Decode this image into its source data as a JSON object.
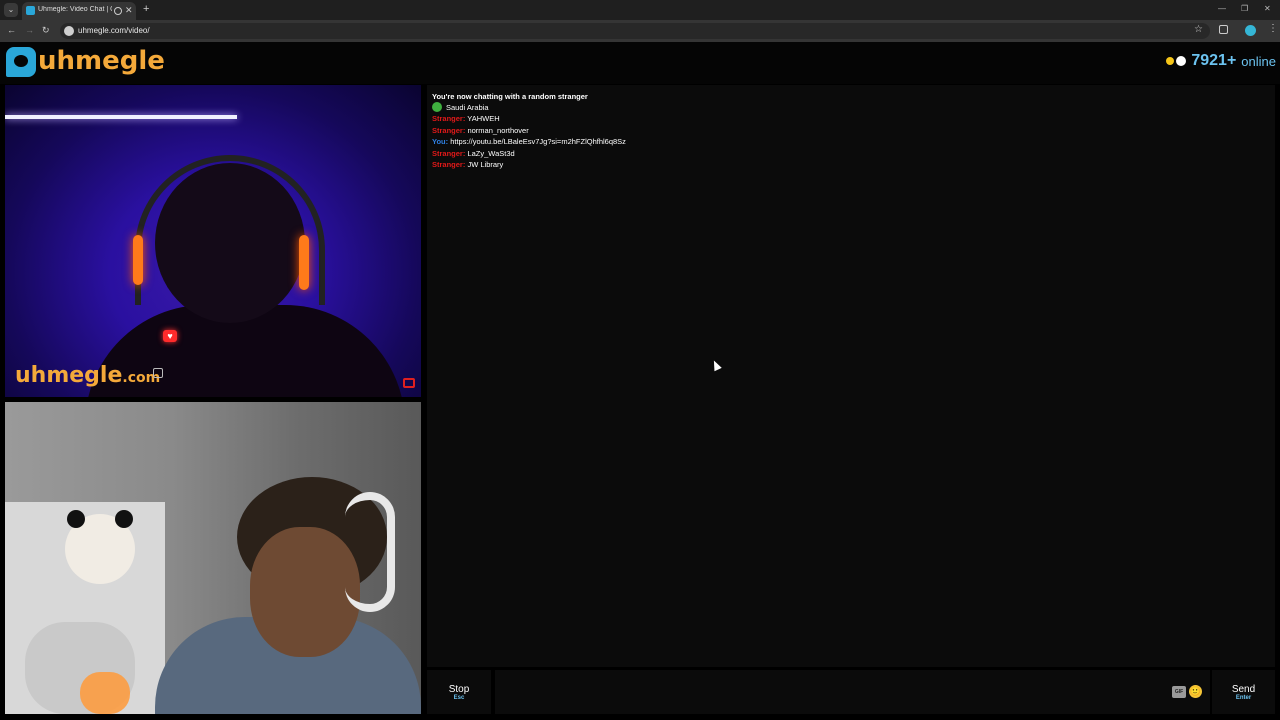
{
  "browser": {
    "tab_title": "Uhmegle: Video Chat | Om",
    "tab_close": "✕",
    "new_tab": "+",
    "url": "uhmegle.com/video/",
    "nav_back": "←",
    "nav_forward": "→",
    "nav_reload": "↻",
    "bookmark_icon": "☆",
    "menu_icon": "⋮",
    "win_min": "—",
    "win_restore": "❐",
    "win_close": "✕",
    "tab_search": "⌄"
  },
  "header": {
    "logo_text": "uhmegle",
    "online_count": "7921+",
    "online_label": "online"
  },
  "stranger_video": {
    "watermark": "uhmegle",
    "watermark_suffix": ".com"
  },
  "chat": {
    "status": "You're now chatting with a random stranger",
    "country": "Saudi Arabia",
    "messages": [
      {
        "sender": "Stranger:",
        "text": "YAHWEH",
        "from": "stranger"
      },
      {
        "sender": "Stranger:",
        "text": "norman_northover",
        "from": "stranger"
      },
      {
        "sender": "You:",
        "text": "https://youtu.be/LBaleEsv7Jg?si=m2hFZlQhfhl6q8Sz",
        "from": "you"
      },
      {
        "sender": "Stranger:",
        "text": "LaZy_WaSt3d",
        "from": "stranger"
      },
      {
        "sender": "Stranger:",
        "text": "JW Library",
        "from": "stranger"
      }
    ]
  },
  "controls": {
    "stop_label": "Stop",
    "stop_key": "Esc",
    "input_placeholder": "",
    "gif_label": "GIF",
    "emoji": "🙂",
    "send_label": "Send",
    "send_key": "Enter"
  },
  "colors": {
    "brand_blue": "#2aa7d9",
    "brand_orange": "#f4a93a",
    "stranger_red": "#e01919",
    "you_blue": "#2f7fe0",
    "online_blue": "#6cc3f0"
  }
}
